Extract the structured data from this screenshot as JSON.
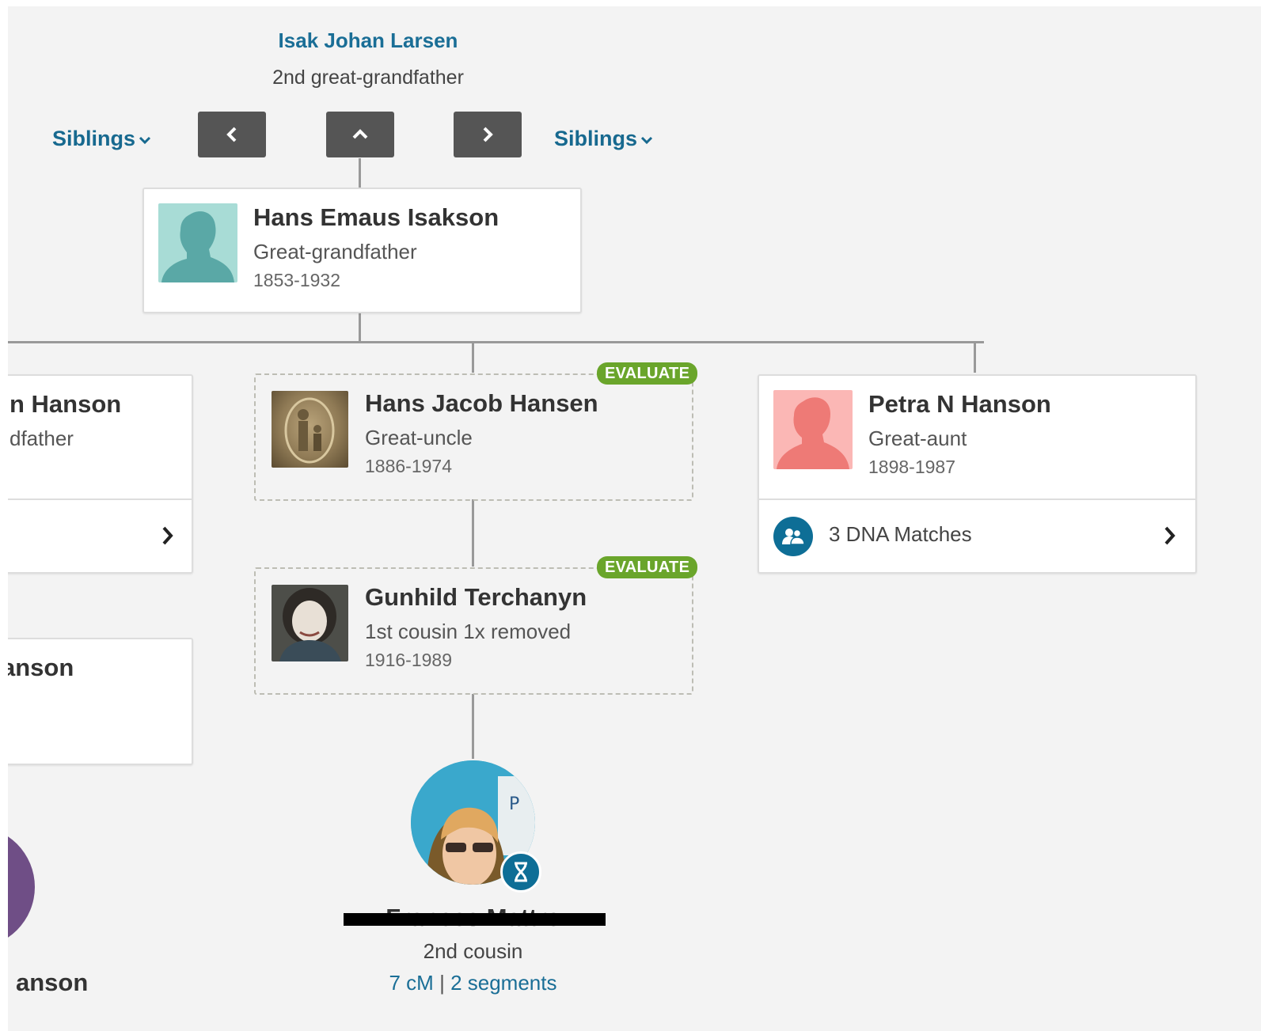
{
  "ancestor": {
    "name": "Isak Johan Larsen",
    "relationship": "2nd great-grandfather"
  },
  "nav": {
    "siblings_left_label": "Siblings",
    "siblings_right_label": "Siblings"
  },
  "focus_person": {
    "name": "Hans Emaus Isakson",
    "relationship": "Great-grandfather",
    "dates": "1853-1932"
  },
  "children": [
    {
      "name_partial": "n Hanson",
      "relationship_partial": "dfather"
    },
    {
      "name": "Hans Jacob Hansen",
      "relationship": "Great-uncle",
      "dates": "1886-1974",
      "badge": "EVALUATE"
    },
    {
      "name": "Petra N Hanson",
      "relationship": "Great-aunt",
      "dates": "1898-1987",
      "dna_matches": "3 DNA Matches"
    }
  ],
  "left_lower": {
    "card_name_partial": "anson",
    "match_name_partial": "anson"
  },
  "grandchild": {
    "name": "Gunhild Terchanyn",
    "relationship": "1st cousin 1x removed",
    "dates": "1916-1989",
    "badge": "EVALUATE"
  },
  "dna_match": {
    "name": "Frances Mattre",
    "relationship": "2nd cousin",
    "shared_cm": "7 cM",
    "separator": "|",
    "segments": "2 segments"
  },
  "colors": {
    "link_blue": "#1a6e96",
    "nav_button": "#555555",
    "evaluate_green": "#6aa52b",
    "male_silhouette": "#5aa8a6",
    "female_silhouette": "#ee7a76",
    "dna_icon": "#0e6e96",
    "purple_avatar": "#6f4e86"
  },
  "icons": [
    "chevron-down-icon",
    "chevron-left-icon",
    "chevron-up-icon",
    "chevron-right-icon",
    "dna-matches-icon",
    "dna-helix-icon",
    "male-silhouette-icon",
    "female-silhouette-icon"
  ]
}
